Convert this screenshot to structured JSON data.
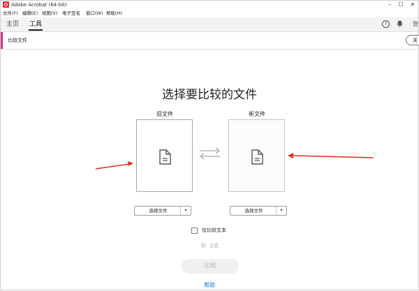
{
  "window": {
    "title": "Adobe Acrobat (64-bit)",
    "controls": [
      "–",
      "☐",
      "✕"
    ]
  },
  "menu": [
    "文件(F)",
    "编辑(E)",
    "视图(V)",
    "电子签名",
    "窗口(W)",
    "帮助(H)"
  ],
  "tabs": [
    "主页",
    "工具"
  ],
  "toolbar": {
    "tool_name": "比较文件",
    "close_label": "关"
  },
  "main": {
    "headline": "选择要比较的文件",
    "old_label": "旧文件",
    "new_label": "新文件",
    "select_label": "选择文件",
    "compare_text_only": "仅比较文本",
    "settings_label": "设置",
    "compare_button": "比较",
    "help_link": "帮助"
  },
  "colors": {
    "accent": "#c8397d",
    "link": "#1473e6",
    "annotation_arrow": "#e0302a"
  }
}
